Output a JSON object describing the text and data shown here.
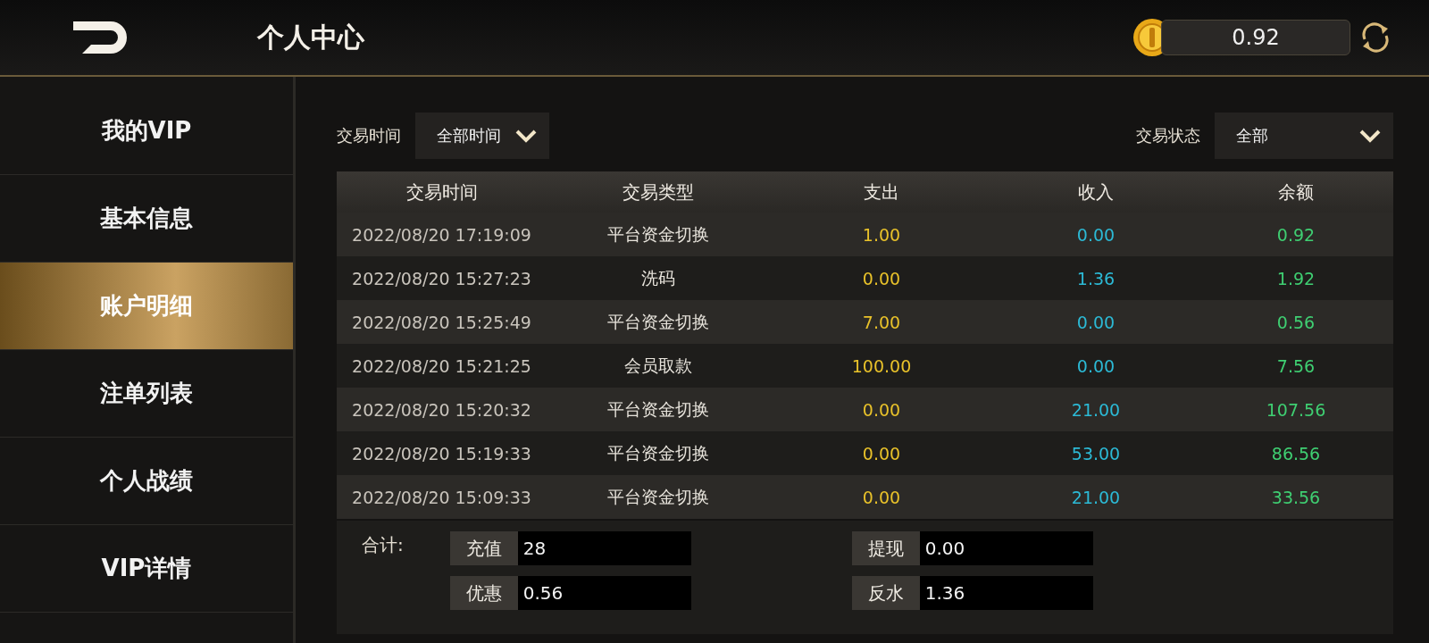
{
  "header": {
    "title": "个人中心",
    "balance": "0.92"
  },
  "sidebar": {
    "items": [
      {
        "label": "我的VIP",
        "selected": false
      },
      {
        "label": "基本信息",
        "selected": false
      },
      {
        "label": "账户明细",
        "selected": true
      },
      {
        "label": "注单列表",
        "selected": false
      },
      {
        "label": "个人战绩",
        "selected": false
      },
      {
        "label": "VIP详情",
        "selected": false
      }
    ]
  },
  "filters": [
    {
      "label": "交易时间",
      "value": "全部时间"
    },
    {
      "label": "交易状态",
      "value": "全部"
    }
  ],
  "table": {
    "columns": [
      {
        "label": "交易时间",
        "kind": "time"
      },
      {
        "label": "交易类型",
        "kind": "type"
      },
      {
        "label": "支出",
        "kind": "expense"
      },
      {
        "label": "收入",
        "kind": "income"
      },
      {
        "label": "余额",
        "kind": "balance"
      }
    ],
    "rows": [
      [
        "2022/08/20 17:19:09",
        "平台资金切换",
        "1.00",
        "0.00",
        "0.92"
      ],
      [
        "2022/08/20 15:27:23",
        "洗码",
        "0.00",
        "1.36",
        "1.92"
      ],
      [
        "2022/08/20 15:25:49",
        "平台资金切换",
        "7.00",
        "0.00",
        "0.56"
      ],
      [
        "2022/08/20 15:21:25",
        "会员取款",
        "100.00",
        "0.00",
        "7.56"
      ],
      [
        "2022/08/20 15:20:32",
        "平台资金切换",
        "0.00",
        "21.00",
        "107.56"
      ],
      [
        "2022/08/20 15:19:33",
        "平台资金切换",
        "0.00",
        "53.00",
        "86.56"
      ],
      [
        "2022/08/20 15:09:33",
        "平台资金切换",
        "0.00",
        "21.00",
        "33.56"
      ]
    ]
  },
  "summary": {
    "label": "合计:",
    "fields": [
      {
        "label": "充值",
        "value": "28"
      },
      {
        "label": "提现",
        "value": "0.00"
      },
      {
        "label": "优惠",
        "value": "0.56"
      },
      {
        "label": "反水",
        "value": "1.36"
      }
    ]
  }
}
